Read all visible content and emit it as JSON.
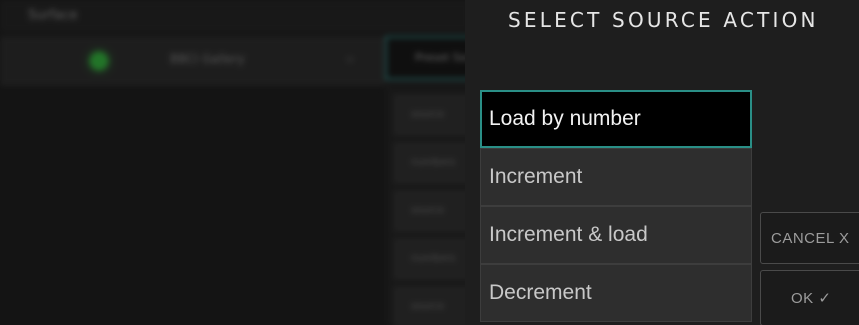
{
  "background": {
    "title": "Surface",
    "row_label": "BBCI Gallery",
    "chevron": "⌄",
    "tab_label": "Preset Source",
    "cells": [
      "source",
      "numbers",
      "source",
      "numbers",
      "source"
    ]
  },
  "modal": {
    "title": "SELECT SOURCE ACTION",
    "options": [
      {
        "label": "Load by number",
        "selected": true
      },
      {
        "label": "Increment",
        "selected": false
      },
      {
        "label": "Increment & load",
        "selected": false
      },
      {
        "label": "Decrement",
        "selected": false
      }
    ],
    "cancel_label": "CANCEL X",
    "ok_label": "OK ✓"
  },
  "colors": {
    "accent": "#2a8f87",
    "status_led": "#2fc43a"
  }
}
